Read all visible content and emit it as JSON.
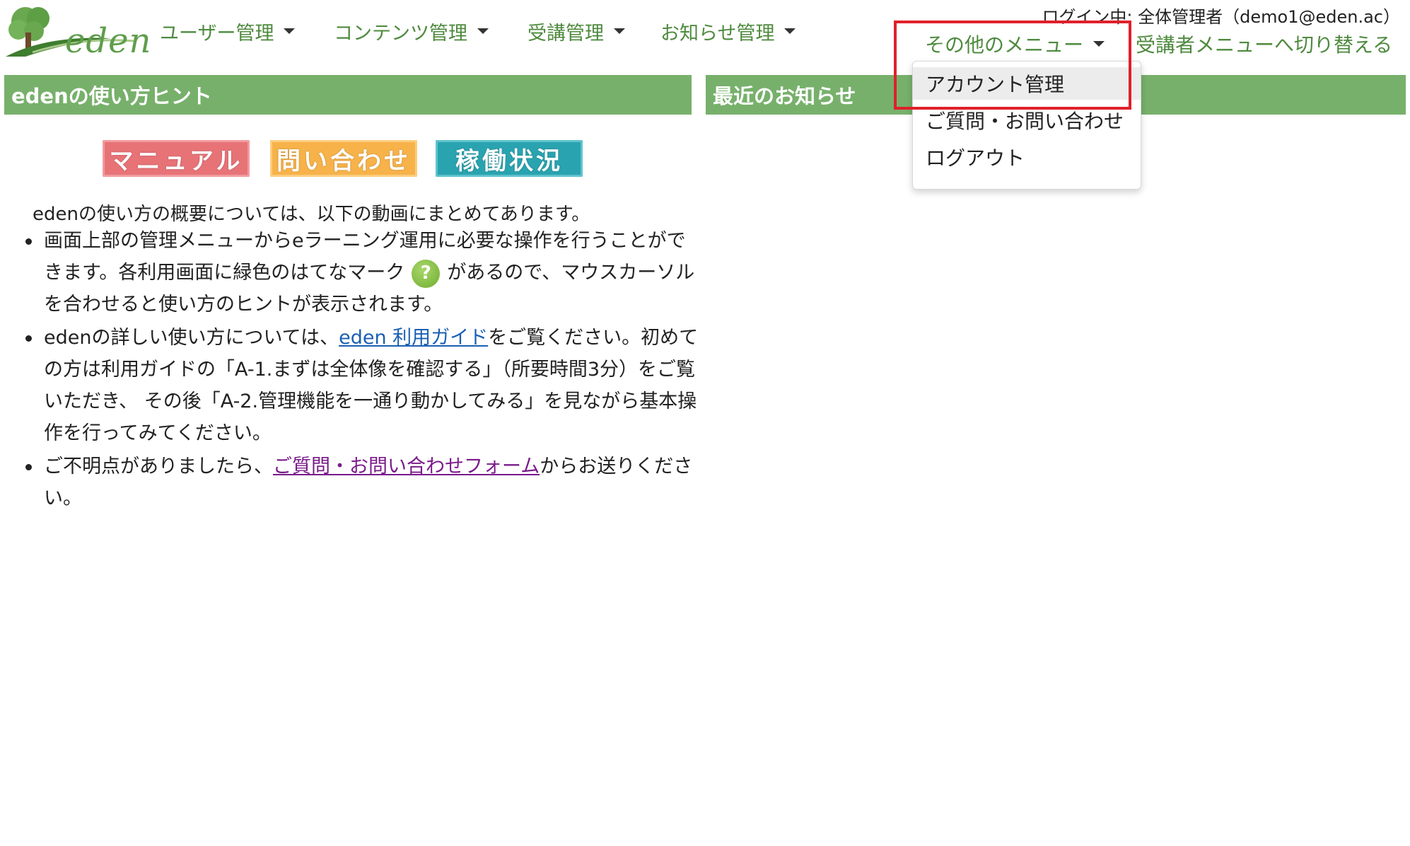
{
  "app": {
    "logo_text": "eden"
  },
  "header": {
    "nav": [
      {
        "label": "ユーザー管理"
      },
      {
        "label": "コンテンツ管理"
      },
      {
        "label": "受講管理"
      },
      {
        "label": "お知らせ管理"
      }
    ],
    "login_info": "ログイン中: 全体管理者（demo1@eden.ac）",
    "other_menu_label": "その他のメニュー",
    "switch_label": "受講者メニューへ切り替える"
  },
  "dropdown": {
    "items": [
      {
        "label": "アカウント管理",
        "active": true
      },
      {
        "label": "ご質問・お問い合わせ",
        "active": false
      },
      {
        "label": "ログアウト",
        "active": false
      }
    ]
  },
  "hints": {
    "title": "edenの使い方ヒント",
    "buttons": {
      "manual": "マニュアル",
      "contact": "問い合わせ",
      "status": "稼働状況"
    },
    "intro": "edenの使い方の概要については、以下の動画にまとめてあります。",
    "item1_text_a": "画面上部の管理メニューからeラーニング運用に必要な操作を行うことができます。各利用画面に緑色のはてなマーク",
    "item1_icon": "?",
    "item1_text_b": "があるので、マウスカーソルを合わせると使い方のヒントが表示されます。",
    "item2_text_a": "edenの詳しい使い方については、",
    "item2_link": "eden 利用ガイド",
    "item2_text_b": "をご覧ください。初めての方は利用ガイドの「A-1.まずは全体像を確認する」（所要時間3分）をご覧いただき、 その後「A-2.管理機能を一通り動かしてみる」を見ながら基本操作を行ってみてください。",
    "item3_text_a": "ご不明点がありましたら、",
    "item3_link": "ご質問・お問い合わせフォーム",
    "item3_text_b": "からお送りください。"
  },
  "news": {
    "title": "最近のお知らせ"
  },
  "colors": {
    "accent_green": "#77b06b",
    "nav_green": "#4e8a3e",
    "highlight_red": "#e0202a",
    "btn_manual": "#e77377",
    "btn_contact": "#f7b24a",
    "btn_status": "#2aa3b0"
  }
}
